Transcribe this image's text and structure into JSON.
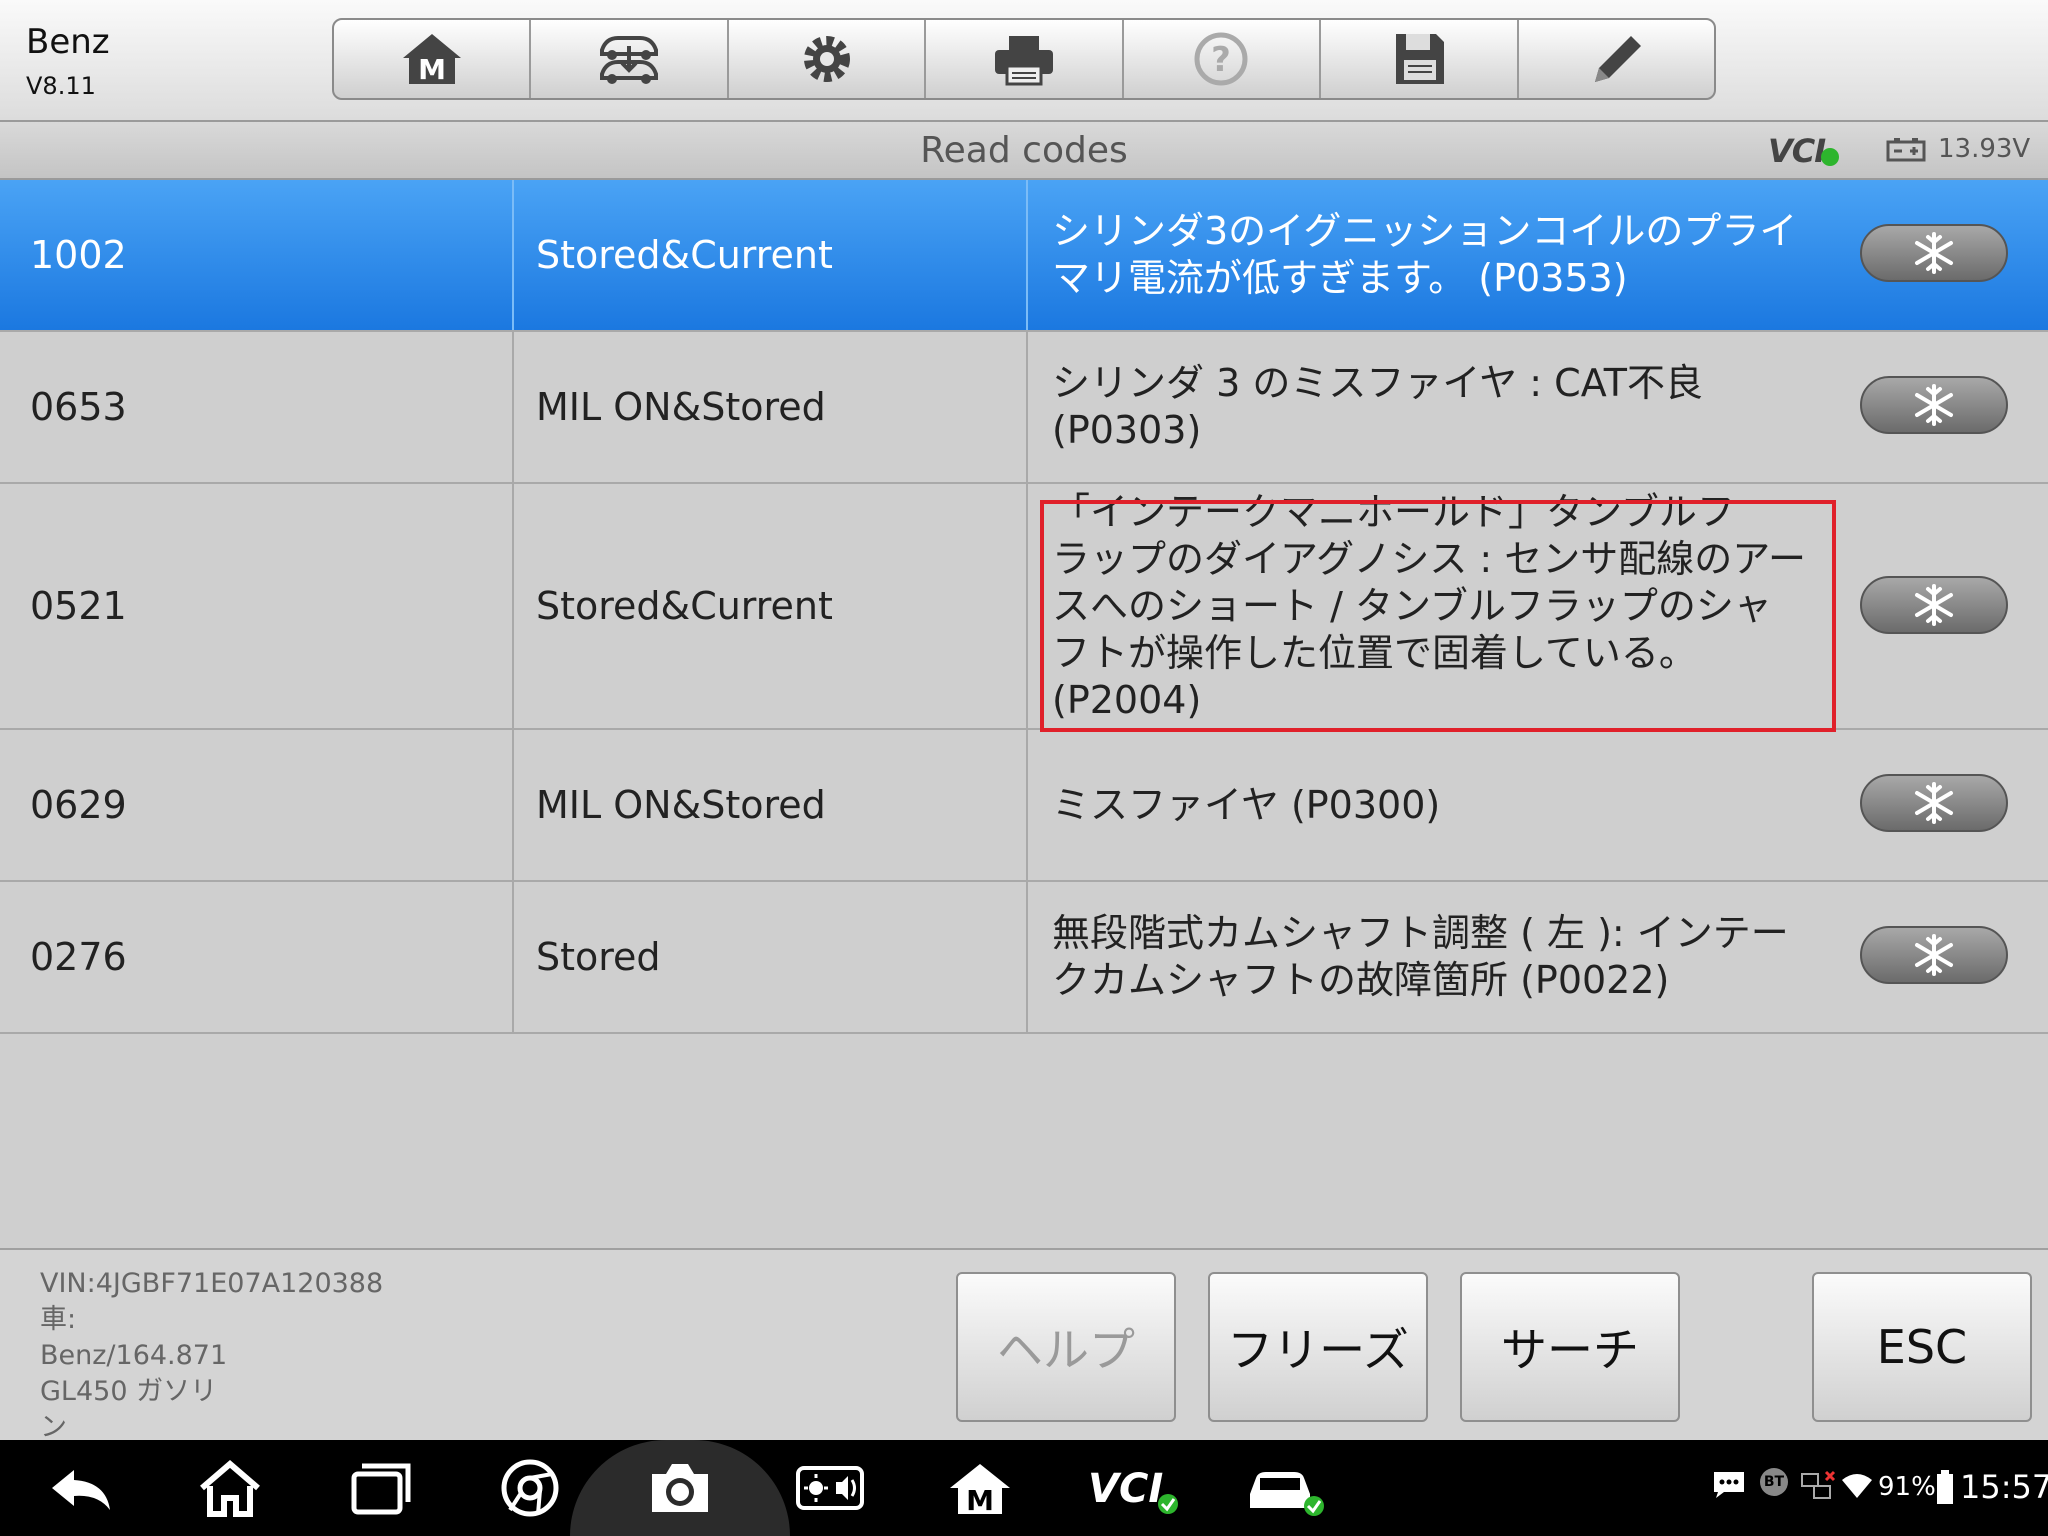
{
  "app": {
    "name": "Benz",
    "version": "V8.11"
  },
  "toolbar": {
    "items": [
      {
        "icon": "home-m-icon"
      },
      {
        "icon": "vehicle-swap-icon"
      },
      {
        "icon": "settings-gear-icon"
      },
      {
        "icon": "printer-icon"
      },
      {
        "icon": "help-question-icon"
      },
      {
        "icon": "save-floppy-icon"
      },
      {
        "icon": "edit-pencil-icon"
      }
    ]
  },
  "titlebar": {
    "title": "Read codes",
    "vci": "VCI",
    "voltage": "13.93V"
  },
  "codes": [
    {
      "code": "1002",
      "status": "Stored&Current",
      "desc": "シリンダ3のイグニッションコイルのプライ\nマリ電流が低すぎます。 (P0353)"
    },
    {
      "code": "0653",
      "status": "MIL ON&Stored",
      "desc": "シリンダ 3 のミスファイヤ : CAT不良\n(P0303)"
    },
    {
      "code": "0521",
      "status": "Stored&Current",
      "desc": "「インテークマニホールド」タンブルフ\nラップのダイアグノシス : センサ配線のアー\nスへのショート / タンブルフラップのシャ\nフトが操作した位置で固着している。\n(P2004)"
    },
    {
      "code": "0629",
      "status": "MIL ON&Stored",
      "desc": "ミスファイヤ (P0300)"
    },
    {
      "code": "0276",
      "status": "Stored",
      "desc": "無段階式カムシャフト調整 ( 左 ): インテー\nクカムシャフトの故障箇所 (P0022)"
    }
  ],
  "footer": {
    "vehicle_info": "VIN:4JGBF71E07A120388\n車:\nBenz/164.871\nGL450 ガソリ\nン",
    "buttons": {
      "help": "ヘルプ",
      "freeze": "フリーズ",
      "search": "サーチ",
      "esc": "ESC"
    }
  },
  "statusbar": {
    "battery": "91%",
    "time": "15:57",
    "bt": "BT"
  }
}
